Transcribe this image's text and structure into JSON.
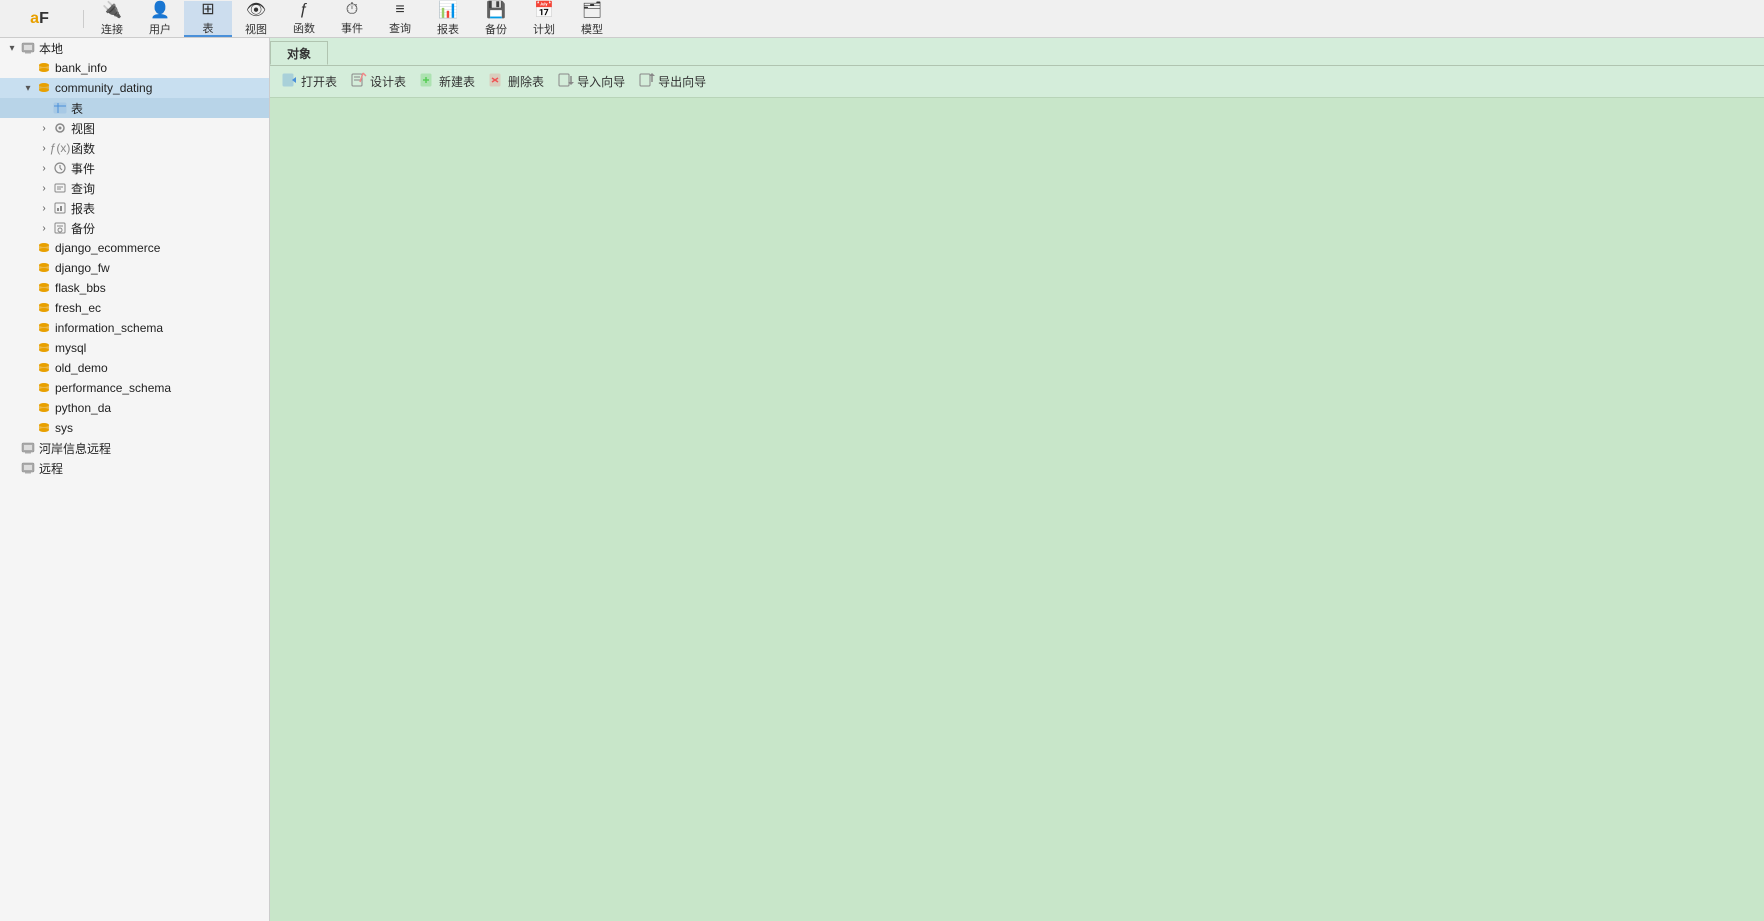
{
  "toolbar": {
    "buttons": [
      {
        "id": "connect",
        "label": "连接",
        "icon": "🔌"
      },
      {
        "id": "user",
        "label": "用户",
        "icon": "👤"
      },
      {
        "id": "table",
        "label": "表",
        "icon": "⊞",
        "active": true
      },
      {
        "id": "view",
        "label": "视图",
        "icon": "👁"
      },
      {
        "id": "function",
        "label": "函数",
        "icon": "ƒ"
      },
      {
        "id": "event",
        "label": "事件",
        "icon": "⏱"
      },
      {
        "id": "query",
        "label": "查询",
        "icon": "≡"
      },
      {
        "id": "report",
        "label": "报表",
        "icon": "📊"
      },
      {
        "id": "backup",
        "label": "备份",
        "icon": "💾"
      },
      {
        "id": "schedule",
        "label": "计划",
        "icon": "📅"
      },
      {
        "id": "model",
        "label": "模型",
        "icon": "🗂"
      }
    ]
  },
  "sidebar": {
    "items": [
      {
        "id": "local",
        "label": "本地",
        "type": "connection",
        "level": 0,
        "expanded": true,
        "toggle": "▾",
        "icon": "🖥"
      },
      {
        "id": "bank_info",
        "label": "bank_info",
        "type": "db",
        "level": 1,
        "toggle": "",
        "icon": "db"
      },
      {
        "id": "community_dating",
        "label": "community_dating",
        "type": "db",
        "level": 1,
        "expanded": true,
        "toggle": "▾",
        "icon": "db",
        "selected": true
      },
      {
        "id": "table_node",
        "label": "表",
        "type": "table-group",
        "level": 2,
        "toggle": "",
        "icon": "table",
        "highlighted": true
      },
      {
        "id": "view_node",
        "label": "视图",
        "type": "view-group",
        "level": 2,
        "toggle": "›",
        "icon": "view"
      },
      {
        "id": "func_node",
        "label": "函数",
        "type": "func-group",
        "level": 2,
        "toggle": "›",
        "icon": "func"
      },
      {
        "id": "event_node",
        "label": "事件",
        "type": "event-group",
        "level": 2,
        "toggle": "›",
        "icon": "event"
      },
      {
        "id": "query_node",
        "label": "查询",
        "type": "query-group",
        "level": 2,
        "toggle": "›",
        "icon": "query"
      },
      {
        "id": "report_node",
        "label": "报表",
        "type": "report-group",
        "level": 2,
        "toggle": "›",
        "icon": "report"
      },
      {
        "id": "backup_node",
        "label": "备份",
        "type": "backup-group",
        "level": 2,
        "toggle": "›",
        "icon": "backup"
      },
      {
        "id": "django_ecommerce",
        "label": "django_ecommerce",
        "type": "db",
        "level": 1,
        "toggle": "",
        "icon": "db"
      },
      {
        "id": "django_fw",
        "label": "django_fw",
        "type": "db",
        "level": 1,
        "toggle": "",
        "icon": "db"
      },
      {
        "id": "flask_bbs",
        "label": "flask_bbs",
        "type": "db",
        "level": 1,
        "toggle": "",
        "icon": "db"
      },
      {
        "id": "fresh_ec",
        "label": "fresh_ec",
        "type": "db",
        "level": 1,
        "toggle": "",
        "icon": "db"
      },
      {
        "id": "information_schema",
        "label": "information_schema",
        "type": "db",
        "level": 1,
        "toggle": "",
        "icon": "db"
      },
      {
        "id": "mysql",
        "label": "mysql",
        "type": "db",
        "level": 1,
        "toggle": "",
        "icon": "db"
      },
      {
        "id": "old_demo",
        "label": "old_demo",
        "type": "db",
        "level": 1,
        "toggle": "",
        "icon": "db"
      },
      {
        "id": "performance_schema",
        "label": "performance_schema",
        "type": "db",
        "level": 1,
        "toggle": "",
        "icon": "db"
      },
      {
        "id": "python_da",
        "label": "python_da",
        "type": "db",
        "level": 1,
        "toggle": "",
        "icon": "db"
      },
      {
        "id": "sys",
        "label": "sys",
        "type": "db",
        "level": 1,
        "toggle": "",
        "icon": "db"
      },
      {
        "id": "heyan_remote",
        "label": "河岸信息远程",
        "type": "connection",
        "level": 0,
        "toggle": "",
        "icon": "🖥"
      },
      {
        "id": "remote",
        "label": "远程",
        "type": "connection",
        "level": 0,
        "toggle": "",
        "icon": "🖥"
      }
    ]
  },
  "tabs": [
    {
      "id": "objects",
      "label": "对象",
      "active": true
    }
  ],
  "object_toolbar": {
    "buttons": [
      {
        "id": "open-table",
        "label": "打开表",
        "icon": "▶"
      },
      {
        "id": "design-table",
        "label": "设计表",
        "icon": "✏"
      },
      {
        "id": "new-table",
        "label": "新建表",
        "icon": "+"
      },
      {
        "id": "delete-table",
        "label": "删除表",
        "icon": "✕"
      },
      {
        "id": "import-wizard",
        "label": "导入向导",
        "icon": "⬇"
      },
      {
        "id": "export-wizard",
        "label": "导出向导",
        "icon": "⬆"
      }
    ]
  }
}
